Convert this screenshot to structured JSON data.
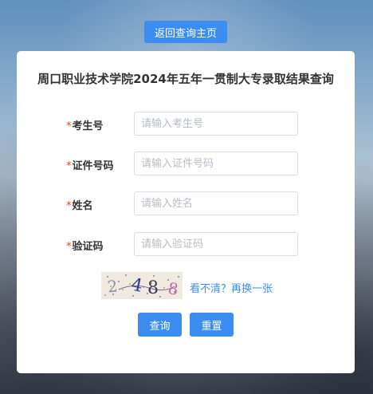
{
  "header": {
    "back_home_label": "返回查询主页"
  },
  "form": {
    "title": "周口职业技术学院2024年五年一贯制大专录取结果查询",
    "required_mark": "*",
    "fields": [
      {
        "label": "考生号",
        "placeholder": "请输入考生号"
      },
      {
        "label": "证件号码",
        "placeholder": "请输入证件号码"
      },
      {
        "label": "姓名",
        "placeholder": "请输入姓名"
      },
      {
        "label": "验证码",
        "placeholder": "请输入验证码"
      }
    ],
    "captcha_text": "2488",
    "refresh_label": "看不清？再换一张",
    "query_label": "查询",
    "reset_label": "重置"
  }
}
